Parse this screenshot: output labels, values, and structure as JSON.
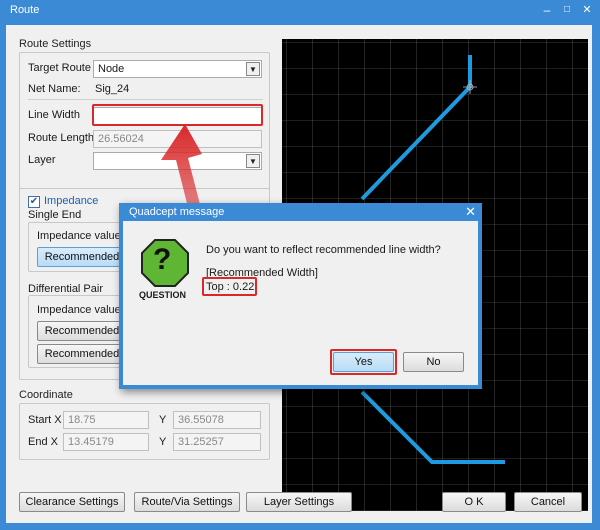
{
  "window": {
    "title": "Route",
    "min": "–",
    "max": "□",
    "close": "✕"
  },
  "route_settings": {
    "title": "Route Settings",
    "target_route_label": "Target Route",
    "target_route_value": "Node",
    "net_name_label": "Net Name:",
    "net_name_value": "Sig_24",
    "line_width_label": "Line Width",
    "line_width_value": "",
    "route_length_label": "Route Length",
    "route_length_value": "26.56024",
    "layer_label": "Layer",
    "layer_value": ""
  },
  "impedance": {
    "checkbox_label": "Impedance",
    "checked": true,
    "single_end_title": "Single End",
    "single_end_value_label": "Impedance value:5",
    "single_end_button": "Recommended",
    "diff_pair_title": "Differential Pair",
    "diff_value_label": "Impedance value:8",
    "diff_button1": "Recommended",
    "diff_button2": "Recommended"
  },
  "coordinate": {
    "title": "Coordinate",
    "start_x_label": "Start X",
    "start_x_value": "18.75",
    "start_y_label": "Y",
    "start_y_value": "36.55078",
    "end_x_label": "End X",
    "end_x_value": "13.45179",
    "end_y_label": "Y",
    "end_y_value": "31.25257"
  },
  "footer": {
    "clearance": "Clearance Settings",
    "route_via": "Route/Via Settings",
    "layer": "Layer Settings",
    "ok": "O K",
    "cancel": "Cancel"
  },
  "dialog": {
    "title": "Quadcept message",
    "close": "✕",
    "question": "Do you want to reflect recommended line width?",
    "recommended_label": "[Recommended Width]",
    "top_value": "Top : 0.22",
    "icon_caption": "QUESTION",
    "icon_glyph": "?",
    "yes": "Yes",
    "no": "No"
  },
  "colors": {
    "title_bar": "#3b8ad6",
    "highlight": "#d9282a",
    "trace": "#1e9be0",
    "canvas": "#000000"
  }
}
